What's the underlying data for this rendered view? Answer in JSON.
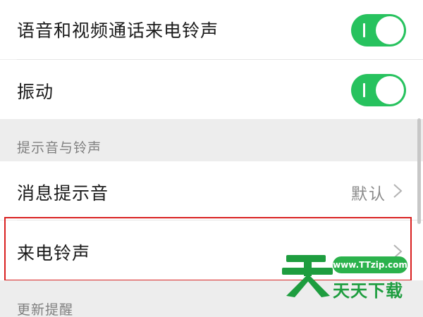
{
  "settings": {
    "call_ringtone_toggle": {
      "label": "语音和视频通话来电铃声",
      "on": true
    },
    "vibration_toggle": {
      "label": "振动",
      "on": true
    },
    "section_sounds": {
      "title": "提示音与铃声"
    },
    "message_sound": {
      "label": "消息提示音",
      "value": "默认"
    },
    "incoming_ringtone": {
      "label": "来电铃声"
    },
    "section_updates": {
      "title": "更新提醒"
    }
  },
  "watermark": {
    "logo_char": "天",
    "url": "www.TTzip.com",
    "name": "天天下载"
  },
  "colors": {
    "toggle_on": "#27c25e",
    "highlight_border": "#d92020",
    "watermark_green": "#2bb24c"
  }
}
